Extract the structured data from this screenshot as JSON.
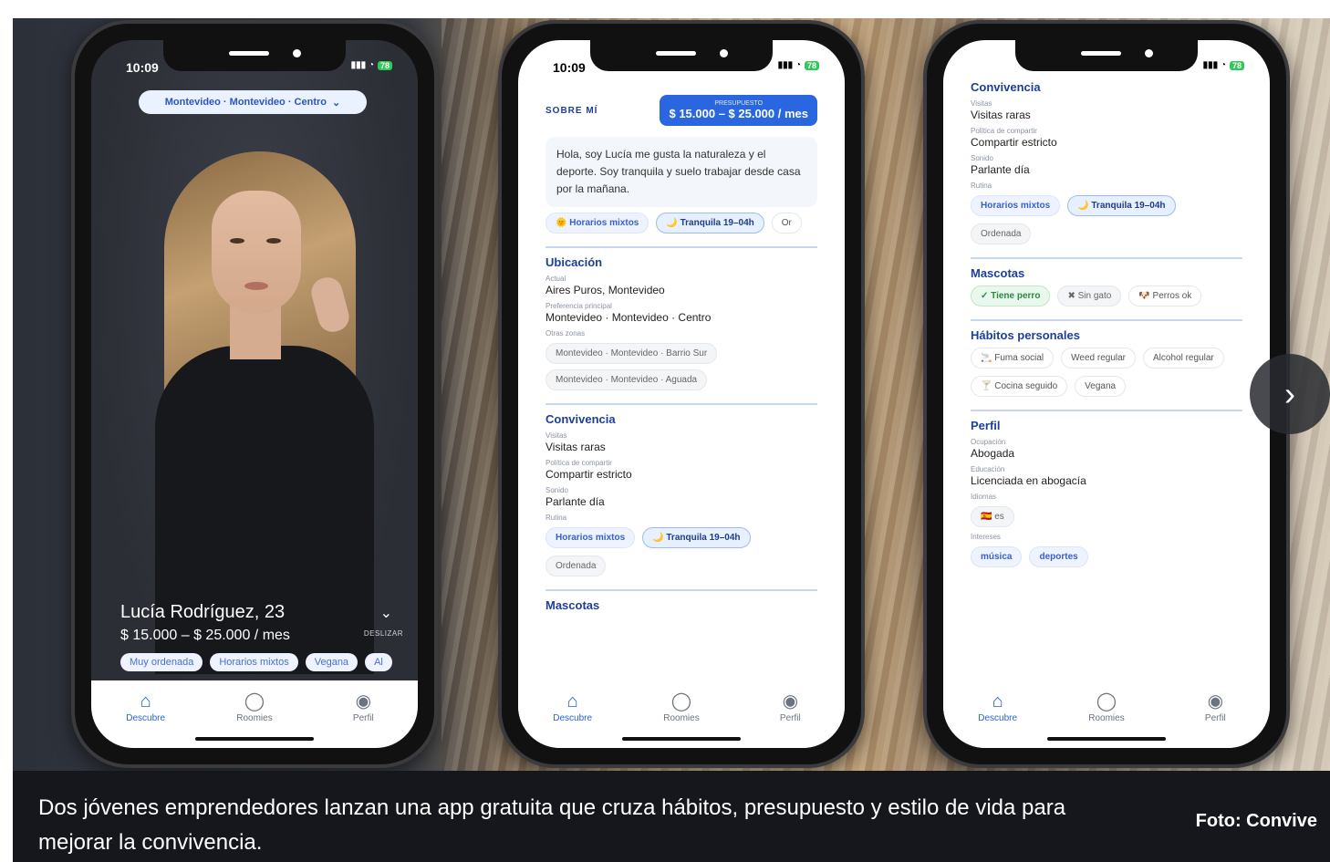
{
  "phones": {
    "p1": {
      "time": "10:09",
      "battery": "78",
      "location": "Montevideo · Montevideo · Centro",
      "name": "Lucía Rodríguez, 23",
      "price": "$ 15.000 – $ 25.000 / mes",
      "swipe_hint": "DESLIZAR",
      "tags": [
        "Muy ordenada",
        "Horarios mixtos",
        "Vegana",
        "Al"
      ]
    },
    "p2": {
      "time": "10:09",
      "battery": "78",
      "about_label": "SOBRE MÍ",
      "budget_label": "PRESUPUESTO",
      "budget_value": "$ 15.000 – $ 25.000 / mes",
      "bio": "Hola, soy Lucía me gusta la naturaleza y el deporte. Soy tranquila y suelo trabajar desde casa por la mañana.",
      "bio_chips": [
        "🌞 Horarios mixtos",
        "🌙 Tranquila 19–04h",
        "Or"
      ],
      "ubicacion": {
        "title": "Ubicación",
        "actual_label": "Actual",
        "actual": "Aires Puros, Montevideo",
        "pref_label": "Preferencia principal",
        "pref": "Montevideo · Montevideo · Centro",
        "other_label": "Otras zonas",
        "other": [
          "Montevideo · Montevideo · Barrio Sur",
          "Montevideo · Montevideo · Aguada"
        ]
      },
      "convivencia": {
        "title": "Convivencia",
        "visitas_label": "Visitas",
        "visitas": "Visitas raras",
        "politica_label": "Política de compartir",
        "politica": "Compartir estricto",
        "sonido_label": "Sonido",
        "sonido": "Parlante día",
        "rutina_label": "Rutina",
        "rutina": [
          "Horarios mixtos",
          "🌙 Tranquila 19–04h",
          "Ordenada"
        ]
      },
      "next_title": "Mascotas"
    },
    "p3": {
      "battery": "78",
      "convivencia": {
        "title": "Convivencia",
        "visitas_label": "Visitas",
        "visitas": "Visitas raras",
        "politica_label": "Política de compartir",
        "politica": "Compartir estricto",
        "sonido_label": "Sonido",
        "sonido": "Parlante día",
        "rutina_label": "Rutina",
        "rutina": [
          "Horarios mixtos",
          "🌙 Tranquila 19–04h",
          "Ordenada"
        ]
      },
      "mascotas": {
        "title": "Mascotas",
        "chips": [
          "✓ Tiene perro",
          "✖ Sin gato",
          "🐶 Perros ok"
        ]
      },
      "habitos": {
        "title": "Hábitos personales",
        "chips": [
          "🚬 Fuma social",
          "Weed regular",
          "Alcohol regular",
          "🍸 Cocina seguido",
          "Vegana"
        ]
      },
      "perfil": {
        "title": "Perfil",
        "ocupacion_label": "Ocupación",
        "ocupacion": "Abogada",
        "educacion_label": "Educación",
        "educacion": "Licenciada en abogacía",
        "idiomas_label": "Idiomas",
        "idiomas": "🇪🇸 es",
        "intereses_label": "Intereses",
        "intereses": [
          "música",
          "deportes"
        ]
      }
    },
    "tabs": [
      "Descubre",
      "Roomies",
      "Perfil"
    ]
  },
  "caption": {
    "text": "Dos jóvenes emprendedores lanzan una app gratuita que cruza hábitos, presupuesto y estilo de vida para mejorar la convivencia.",
    "credit": "Foto:  Convive"
  },
  "colors": {
    "accent": "#2a66e0",
    "section_title": "#1d3f9a",
    "caption_bg": "#15171c"
  },
  "icons": [
    "home-icon",
    "chat-icon",
    "profile-icon",
    "chevron-right-icon",
    "chevron-down-icon"
  ]
}
